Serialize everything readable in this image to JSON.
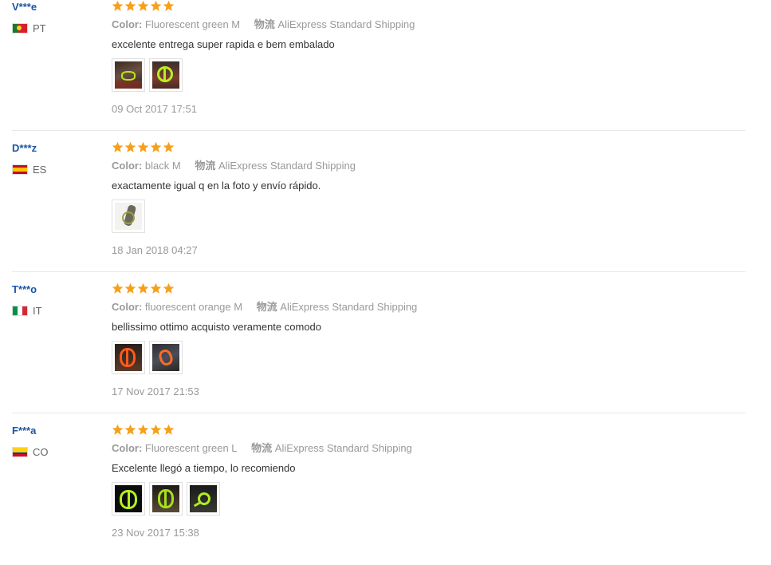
{
  "labels": {
    "color": "Color:",
    "shipping": "物流"
  },
  "colors": {
    "username": "#1a56a6",
    "star": "#f6a01a",
    "muted": "#999999",
    "divider": "#e8e8e8"
  },
  "reviews": [
    {
      "user": "V***e",
      "country": "PT",
      "flag": "portugal-flag-icon",
      "stars": 5,
      "color_value": "Fluorescent green M",
      "shipping_value": "AliExpress Standard Shipping",
      "text": "excelente entrega super rapida e bem embalado",
      "photos": [
        "review-photo",
        "review-photo"
      ],
      "date": "09 Oct 2017 17:51"
    },
    {
      "user": "D***z",
      "country": "ES",
      "flag": "spain-flag-icon",
      "stars": 5,
      "color_value": "black M",
      "shipping_value": "AliExpress Standard Shipping",
      "text": "exactamente igual q en la foto y envío rápido.",
      "photos": [
        "review-photo"
      ],
      "date": "18 Jan 2018 04:27"
    },
    {
      "user": "T***o",
      "country": "IT",
      "flag": "italy-flag-icon",
      "stars": 5,
      "color_value": "fluorescent orange M",
      "shipping_value": "AliExpress Standard Shipping",
      "text": "bellissimo ottimo acquisto veramente comodo",
      "photos": [
        "review-photo",
        "review-photo"
      ],
      "date": "17 Nov 2017 21:53"
    },
    {
      "user": "F***a",
      "country": "CO",
      "flag": "colombia-flag-icon",
      "stars": 5,
      "color_value": "Fluorescent green L",
      "shipping_value": "AliExpress Standard Shipping",
      "text": "Excelente llegó a tiempo, lo recomiendo",
      "photos": [
        "review-photo",
        "review-photo",
        "review-photo"
      ],
      "date": "23 Nov 2017 15:38"
    }
  ]
}
